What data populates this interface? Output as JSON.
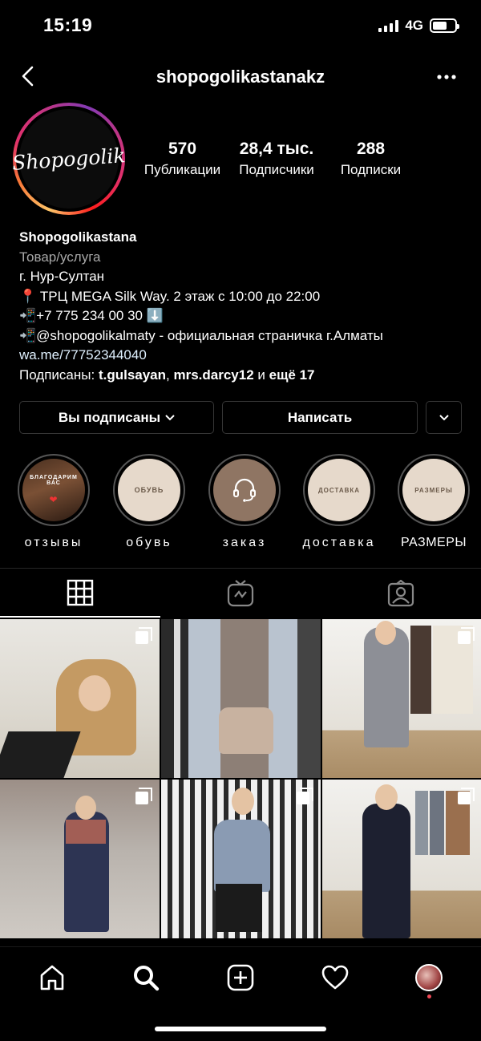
{
  "status_bar": {
    "time": "15:19",
    "network": "4G",
    "battery_level": 0.65
  },
  "header": {
    "username": "shopogolikastanakz"
  },
  "profile": {
    "logo_text": "Shopogolik",
    "stats": [
      {
        "value": "570",
        "label": "Публикации"
      },
      {
        "value": "28,4 тыс.",
        "label": "Подписчики"
      },
      {
        "value": "288",
        "label": "Подписки"
      }
    ],
    "name": "Shopogolikastana",
    "category": "Товар/услуга",
    "bio_lines": [
      "г. Нур-Султан",
      "📍 ТРЦ MEGA Silk Way.  2 этаж с 10:00 до 22:00",
      "📲+7 775 234 00 30 ⬇️",
      "📲@shopogolikalmaty - официальная страничка г.Алматы"
    ],
    "link": "wa.me/77752344040",
    "followed_by_prefix": "Подписаны: ",
    "followed_by_user1": "t.gulsayan",
    "followed_by_sep": ", ",
    "followed_by_user2": "mrs.darcy12",
    "followed_by_and": " и ",
    "followed_by_more": "ещё 17"
  },
  "buttons": {
    "following": "Вы подписаны",
    "message": "Написать"
  },
  "highlights": [
    {
      "label": "отзывы",
      "cover_text": "БЛАГОДАРИМ ВАС"
    },
    {
      "label": "обувь",
      "cover_text": "ОБУВЬ"
    },
    {
      "label": "заказ",
      "cover_text": ""
    },
    {
      "label": "доставка",
      "cover_text": "ДОСТАВКА"
    },
    {
      "label": "РАЗМЕРЫ",
      "cover_text": "РАЗМЕРЫ"
    }
  ],
  "colors": {
    "accent_highlight": "#e8dccf",
    "story_gradient": [
      "#fdc468",
      "#e1306c",
      "#833ab4"
    ],
    "notification_dot": "#ed4956"
  },
  "grid_posts_count_visible": 6
}
